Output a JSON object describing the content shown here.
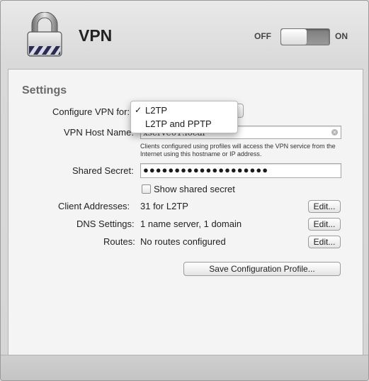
{
  "header": {
    "title": "VPN",
    "toggle": {
      "off_label": "OFF",
      "on_label": "ON",
      "state": "off"
    }
  },
  "settings": {
    "section_title": "Settings",
    "configure_label": "Configure VPN for:",
    "configure_options": [
      "L2TP",
      "L2TP and PPTP"
    ],
    "configure_selected": "L2TP",
    "host_label": "VPN Host Name:",
    "host_value": "xserve01.local",
    "host_hint": "Clients configured using profiles will access the VPN service from the Internet using this hostname or IP address.",
    "secret_label": "Shared Secret:",
    "secret_value": "●●●●●●●●●●●●●●●●●●●●",
    "show_secret_label": "Show shared secret",
    "show_secret_checked": false,
    "client_addresses_label": "Client Addresses:",
    "client_addresses_value": "31 for L2TP",
    "dns_label": "DNS Settings:",
    "dns_value": "1 name server, 1 domain",
    "routes_label": "Routes:",
    "routes_value": "No routes configured",
    "edit_label": "Edit...",
    "save_profile_label": "Save Configuration Profile..."
  },
  "menu": {
    "check_mark": "✓"
  },
  "icons": [
    "lock-icon",
    "clear-icon",
    "checkbox-icon"
  ]
}
